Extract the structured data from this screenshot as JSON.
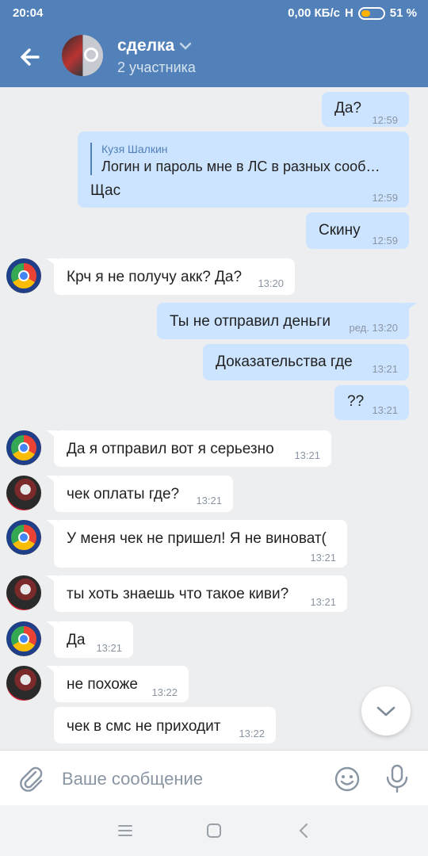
{
  "status_bar": {
    "time": "20:04",
    "network": "0,00 КБ/с",
    "signal": "H",
    "battery_percent": "51 %",
    "battery_level": 0.51
  },
  "header": {
    "title": "сделка",
    "subtitle": "2 участника",
    "accent_color": "#5181b8"
  },
  "messages": [
    {
      "side": "out",
      "text": "Да?",
      "time": "12:59"
    },
    {
      "side": "out",
      "reply_author": "Кузя Шалкин",
      "reply_text": "Логин и пароль мне в ЛС в разных сообщ…",
      "text": "Щас",
      "time": "12:59"
    },
    {
      "side": "out",
      "text": "Скину",
      "time": "12:59"
    },
    {
      "side": "in",
      "avatar": "chrome-avatar",
      "text": "Крч я не получу акк? Да?",
      "time": "13:20"
    },
    {
      "side": "out",
      "text": "Ты не отправил деньги",
      "time": "ред. 13:20"
    },
    {
      "side": "out",
      "text": "Доказательства где",
      "time": "13:21"
    },
    {
      "side": "out",
      "text": "??",
      "time": "13:21"
    },
    {
      "side": "in",
      "avatar": "chrome-avatar",
      "text": "Да я отправил вот я серьезно",
      "time": "13:21"
    },
    {
      "side": "in",
      "avatar": "photo-avatar",
      "text": "чек оплаты где?",
      "time": "13:21"
    },
    {
      "side": "in",
      "avatar": "chrome-avatar",
      "text": "У меня чек не пришел! Я не виноват(",
      "time": "13:21"
    },
    {
      "side": "in",
      "avatar": "photo-avatar",
      "text": "ты хоть знаешь что такое киви?",
      "time": "13:21"
    },
    {
      "side": "in",
      "avatar": "chrome-avatar",
      "text": "Да",
      "time": "13:21"
    },
    {
      "side": "in",
      "avatar": "photo-avatar",
      "text": "не похоже",
      "time": "13:22"
    },
    {
      "side": "in",
      "text": "чек в смс не приходит",
      "time": "13:22"
    }
  ],
  "composer": {
    "placeholder": "Ваше сообщение"
  },
  "icons": {
    "back": "arrow-left-icon",
    "dropdown": "chevron-down-icon",
    "attach": "paperclip-icon",
    "emoji": "smiley-icon",
    "mic": "microphone-icon",
    "scroll": "chevron-down-icon"
  }
}
